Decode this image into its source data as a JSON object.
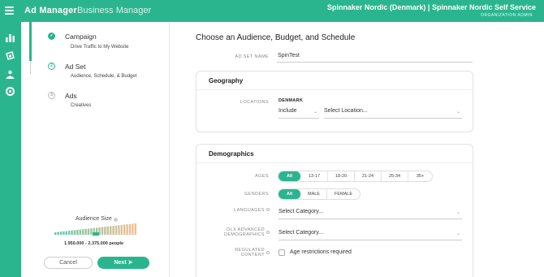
{
  "topbar": {
    "title": "Ad Manager",
    "subtitle": "Business Manager",
    "org": "Spinnaker Nordic (Denmark)  |  Spinnaker Nordic Self Service",
    "role": "ORGANIZATION ADMIN"
  },
  "sidebar_icons": [
    "bar-chart-icon",
    "campaign-icon",
    "audience-icon",
    "settings-icon"
  ],
  "steps": [
    {
      "title": "Campaign",
      "subtitle": "Drive Traffic to My Website",
      "marker": "✓"
    },
    {
      "title": "Ad Set",
      "subtitle": "Audience, Schedule, & Budget",
      "marker": "2"
    },
    {
      "title": "Ads",
      "subtitle": "Creatives",
      "marker": "3"
    }
  ],
  "audience": {
    "label": "Audience Size",
    "range": "1.950.000 - 2.375.000 people"
  },
  "buttons": {
    "cancel": "Cancel",
    "next": "Next"
  },
  "main": {
    "title": "Choose an Audience, Budget, and Schedule",
    "adset_label": "AD SET NAME",
    "adset_value": "SpinTest"
  },
  "geography": {
    "title": "Geography",
    "locations_label": "LOCATIONS",
    "country": "DENMARK",
    "include": "Include",
    "location_placeholder": "Select Location..."
  },
  "demographics": {
    "title": "Demographics",
    "ages_label": "AGES",
    "ages": [
      "All",
      "13-17",
      "18-20",
      "21-24",
      "25-34",
      "35+"
    ],
    "genders_label": "GENDERS",
    "genders": [
      "All",
      "MALE",
      "FEMALE"
    ],
    "languages_label": "LANGUAGES",
    "languages_placeholder": "Select Category...",
    "dlx_label": "DLX ADVANCED DEMOGRAPHICS",
    "dlx_placeholder": "Select Category...",
    "regulated_label": "REGULATED CONTENT",
    "age_restriction": "Age restrictions required"
  },
  "colors": {
    "accent": "#2bb58f"
  }
}
